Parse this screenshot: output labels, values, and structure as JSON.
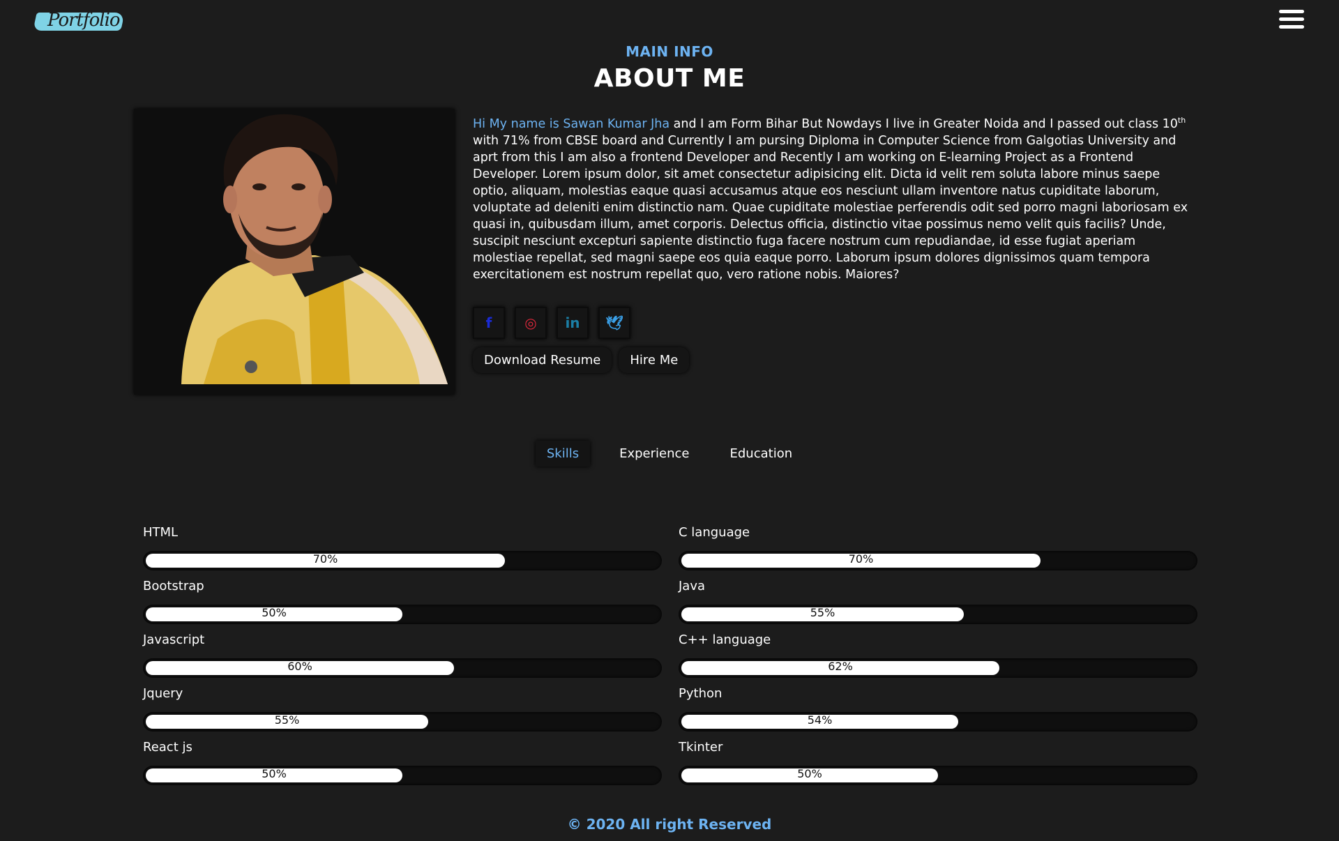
{
  "header": {
    "logo_text": "Portfolio",
    "menu_icon": "hamburger-menu-icon"
  },
  "section": {
    "subtitle": "MAIN INFO",
    "title": "ABOUT ME"
  },
  "about": {
    "highlight": "Hi My name is Sawan Kumar Jha",
    "text_part1": " and I am Form Bihar But Nowdays I live in Greater Noida and I passed out class 10",
    "sup": "th",
    "text_part2": " with 71% from CBSE board and Currently I am pursing Diploma in Computer Science from Galgotias University and aprt from this I am also a frontend Developer and Recently I am working on E-learning Project as a Frontend Developer. Lorem ipsum dolor, sit amet consectetur adipisicing elit. Dicta id velit rem soluta labore minus saepe optio, aliquam, molestias eaque quasi accusamus atque eos nesciunt ullam inventore natus cupiditate laborum, voluptate ad deleniti enim distinctio nam. Quae cupiditate molestiae perferendis odit sed porro magni laboriosam ex quasi in, quibusdam illum, amet corporis. Delectus officia, distinctio vitae possimus nemo velit quis facilis? Unde, suscipit nesciunt excepturi sapiente distinctio fuga facere nostrum cum repudiandae, id esse fugiat aperiam molestiae repellat, sed magni saepe eos quia eaque porro. Laborum ipsum dolores dignissimos quam tempora exercitationem est nostrum repellat quo, vero ratione nobis. Maiores?"
  },
  "socials": [
    {
      "icon": "facebook-icon",
      "glyph": "f",
      "color": "#1a2bd6"
    },
    {
      "icon": "instagram-icon",
      "glyph": "◎",
      "color": "#e0283c"
    },
    {
      "icon": "linkedin-icon",
      "glyph": "in",
      "color": "#1b7fa6"
    },
    {
      "icon": "twitter-icon",
      "glyph": "🕊",
      "color": "#3aa0e8"
    }
  ],
  "buttons": {
    "download": "Download Resume",
    "hire": "Hire Me"
  },
  "tabs": [
    "Skills",
    "Experience",
    "Education"
  ],
  "active_tab": "Skills",
  "skills_left": [
    {
      "name": "HTML",
      "percent": 70,
      "label": "70%"
    },
    {
      "name": "Bootstrap",
      "percent": 50,
      "label": "50%"
    },
    {
      "name": "Javascript",
      "percent": 60,
      "label": "60%"
    },
    {
      "name": "Jquery",
      "percent": 55,
      "label": "55%"
    },
    {
      "name": "React js",
      "percent": 50,
      "label": "50%"
    }
  ],
  "skills_right": [
    {
      "name": "C language",
      "percent": 70,
      "label": "70%"
    },
    {
      "name": "Java",
      "percent": 55,
      "label": "55%"
    },
    {
      "name": "C++ language",
      "percent": 62,
      "label": "62%"
    },
    {
      "name": "Python",
      "percent": 54,
      "label": "54%"
    },
    {
      "name": "Tkinter",
      "percent": 50,
      "label": "50%"
    }
  ],
  "footer": "© 2020 All right Reserved",
  "colors": {
    "accent": "#6db3f2",
    "background": "#1c1c1c"
  }
}
